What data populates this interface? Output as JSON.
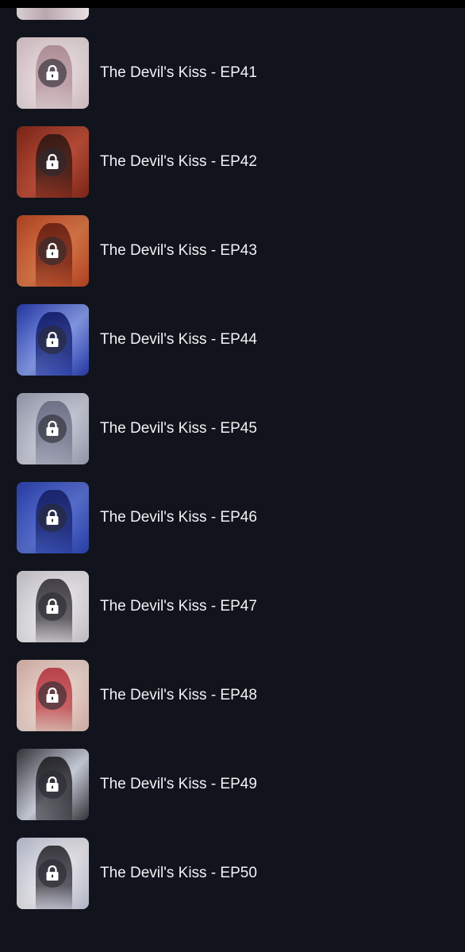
{
  "episodes": [
    {
      "title": "The Devil's Kiss - EP41",
      "thumb_colors": [
        "#e7d3d8",
        "#b48f9a",
        "#f1e3e6"
      ],
      "locked": true
    },
    {
      "title": "The Devil's Kiss - EP42",
      "thumb_colors": [
        "#8a2a1c",
        "#2a1712",
        "#c2503a"
      ],
      "locked": true
    },
    {
      "title": "The Devil's Kiss - EP43",
      "thumb_colors": [
        "#c34a26",
        "#6a1d12",
        "#e07a4a"
      ],
      "locked": true
    },
    {
      "title": "The Devil's Kiss - EP44",
      "thumb_colors": [
        "#2a3fb8",
        "#0f1a6a",
        "#8aa0f0"
      ],
      "locked": true
    },
    {
      "title": "The Devil's Kiss - EP45",
      "thumb_colors": [
        "#a5a9bd",
        "#6d7189",
        "#cfd2df"
      ],
      "locked": true
    },
    {
      "title": "The Devil's Kiss - EP46",
      "thumb_colors": [
        "#2e46b8",
        "#141e66",
        "#5c74d8"
      ],
      "locked": true
    },
    {
      "title": "The Devil's Kiss - EP47",
      "thumb_colors": [
        "#d8d6dc",
        "#2c2a30",
        "#f0eef2"
      ],
      "locked": true
    },
    {
      "title": "The Devil's Kiss - EP48",
      "thumb_colors": [
        "#e8c2b8",
        "#c0303a",
        "#f3dcd4"
      ],
      "locked": true
    },
    {
      "title": "The Devil's Kiss - EP49",
      "thumb_colors": [
        "#3a3a40",
        "#1a1a1e",
        "#d6dbe8"
      ],
      "locked": true
    },
    {
      "title": "The Devil's Kiss - EP50",
      "thumb_colors": [
        "#c9cde0",
        "#222028",
        "#f0eff4"
      ],
      "locked": true
    }
  ],
  "colors": {
    "background": "#11141c",
    "text": "#f1f2f4",
    "lock_overlay": "rgba(40, 40, 48, 0.62)"
  },
  "icons": {
    "lock": "lock-icon"
  }
}
